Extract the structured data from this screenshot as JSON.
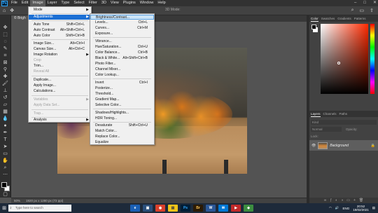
{
  "app": {
    "logo": "Ps"
  },
  "menubar": {
    "items": [
      "File",
      "Edit",
      "Image",
      "Layer",
      "Type",
      "Select",
      "Filter",
      "3D",
      "View",
      "Plugins",
      "Window",
      "Help"
    ],
    "active": "Image",
    "window_controls": [
      "–",
      "□",
      "✕"
    ]
  },
  "options_bar": {
    "mode_3d": "3D Mode:"
  },
  "document_tab": {
    "label": "© Brigh"
  },
  "image_menu": {
    "items": [
      {
        "label": "Mode",
        "submenu": true
      },
      {
        "label": "Adjustments",
        "submenu": true,
        "highlighted": true
      },
      {
        "label": "Auto Tone",
        "shortcut": "Shift+Ctrl+L"
      },
      {
        "label": "Auto Contrast",
        "shortcut": "Alt+Shift+Ctrl+L"
      },
      {
        "label": "Auto Color",
        "shortcut": "Shift+Ctrl+B"
      },
      {
        "label": "Image Size...",
        "shortcut": "Alt+Ctrl+I"
      },
      {
        "label": "Canvas Size...",
        "shortcut": "Alt+Ctrl+C"
      },
      {
        "label": "Image Rotation",
        "submenu": true
      },
      {
        "label": "Crop",
        "disabled": true
      },
      {
        "label": "Trim..."
      },
      {
        "label": "Reveal All",
        "disabled": true
      },
      {
        "label": "Duplicate..."
      },
      {
        "label": "Apply Image..."
      },
      {
        "label": "Calculations..."
      },
      {
        "label": "Variables",
        "submenu": true,
        "disabled": true
      },
      {
        "label": "Apply Data Set...",
        "disabled": true
      },
      {
        "label": "Trap...",
        "disabled": true
      },
      {
        "label": "Analysis",
        "submenu": true
      }
    ]
  },
  "adjustments_menu": {
    "items": [
      {
        "label": "Brightness/Contrast...",
        "highlighted": true
      },
      {
        "label": "Levels...",
        "shortcut": "Ctrl+L"
      },
      {
        "label": "Curves...",
        "shortcut": "Ctrl+M"
      },
      {
        "label": "Exposure..."
      },
      {
        "label": "Vibrance..."
      },
      {
        "label": "Hue/Saturation...",
        "shortcut": "Ctrl+U"
      },
      {
        "label": "Color Balance...",
        "shortcut": "Ctrl+B"
      },
      {
        "label": "Black & White...",
        "shortcut": "Alt+Shift+Ctrl+B"
      },
      {
        "label": "Photo Filter..."
      },
      {
        "label": "Channel Mixer..."
      },
      {
        "label": "Color Lookup..."
      },
      {
        "label": "Invert",
        "shortcut": "Ctrl+I"
      },
      {
        "label": "Posterize..."
      },
      {
        "label": "Threshold..."
      },
      {
        "label": "Gradient Map..."
      },
      {
        "label": "Selective Color..."
      },
      {
        "label": "Shadows/Highlights..."
      },
      {
        "label": "HDR Toning..."
      },
      {
        "label": "Desaturate",
        "shortcut": "Shift+Ctrl+U"
      },
      {
        "label": "Match Color..."
      },
      {
        "label": "Replace Color..."
      },
      {
        "label": "Equalize"
      }
    ]
  },
  "status": {
    "zoom": "50%",
    "doc_info": "1920 px x 1280 px (72 ppi)"
  },
  "color_panel": {
    "tabs": [
      "Color",
      "Swatches",
      "Gradients",
      "Patterns"
    ]
  },
  "layers_panel": {
    "tabs": [
      "Layers",
      "Channels",
      "Paths"
    ],
    "filter": "Kind",
    "blend_mode": "Normal",
    "opacity_label": "Opacity:",
    "lock_label": "Lock:",
    "layer_name": "Background"
  },
  "taskbar": {
    "search_placeholder": "Type here to search",
    "apps": [
      {
        "label": "e",
        "color": "#ffffff",
        "bg": "#1a5fb4"
      },
      {
        "label": "▣",
        "color": "#ffffff",
        "bg": "#2b4f7a"
      },
      {
        "label": "◉",
        "color": "#ffffff",
        "bg": "#d9402b"
      },
      {
        "label": "▤",
        "color": "#3a3a3a",
        "bg": "#f0c419"
      },
      {
        "label": "Ps",
        "color": "#31a8ff",
        "bg": "#001e36"
      },
      {
        "label": "Br",
        "color": "#f7c35a",
        "bg": "#2b1a05"
      },
      {
        "label": "W",
        "color": "#ffffff",
        "bg": "#2b5797"
      },
      {
        "label": "✉",
        "color": "#ffffff",
        "bg": "#0078d4"
      },
      {
        "label": "▶",
        "color": "#ffffff",
        "bg": "#c12a2a"
      },
      {
        "label": "◆",
        "color": "#ffffff",
        "bg": "#3c8d40"
      }
    ],
    "lang": "ENG",
    "time": "20:52",
    "date": "19/02/2021"
  }
}
